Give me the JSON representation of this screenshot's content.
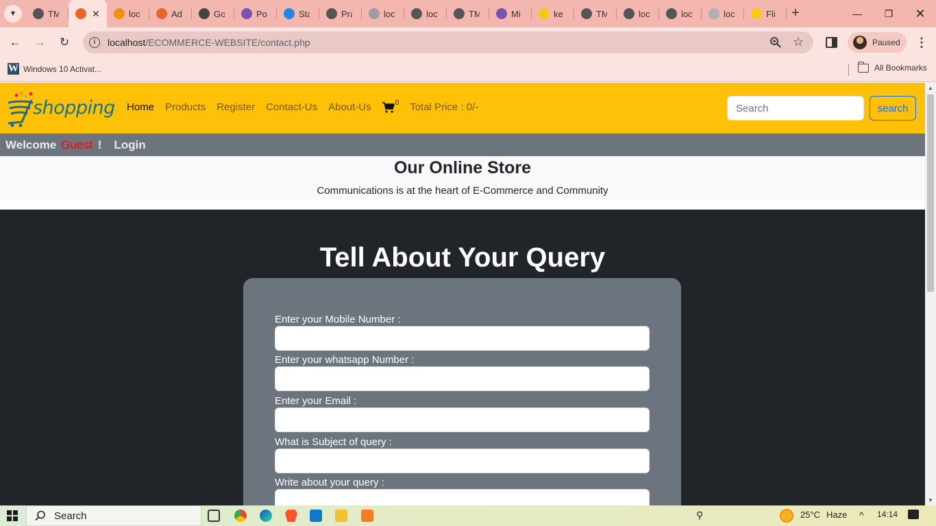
{
  "browser": {
    "tabs": [
      {
        "title": "TM",
        "favicon": "globe-icon",
        "color": "#555555"
      },
      {
        "title": "",
        "favicon": "xampp-icon",
        "color": "#e8652b",
        "active": true
      },
      {
        "title": "loc",
        "favicon": "phpmyadmin-icon",
        "color": "#f29111"
      },
      {
        "title": "Ad",
        "favicon": "xampp-icon",
        "color": "#e8652b"
      },
      {
        "title": "Go",
        "favicon": "gear-icon",
        "color": "#444444"
      },
      {
        "title": "Po",
        "favicon": "bootstrap-icon",
        "color": "#7952b3"
      },
      {
        "title": "Sta",
        "favicon": "lightning-icon",
        "color": "#1e88e5"
      },
      {
        "title": "Pra",
        "favicon": "globe-icon",
        "color": "#555555"
      },
      {
        "title": "loc",
        "favicon": "globe-icon",
        "color": "#9e9e9e"
      },
      {
        "title": "loc",
        "favicon": "globe-icon",
        "color": "#555555"
      },
      {
        "title": "TM",
        "favicon": "globe-icon",
        "color": "#555555"
      },
      {
        "title": "Mi",
        "favicon": "bootstrap-icon",
        "color": "#7952b3"
      },
      {
        "title": "ke",
        "favicon": "bulb-icon",
        "color": "#f7c815"
      },
      {
        "title": "TM",
        "favicon": "globe-icon",
        "color": "#555555"
      },
      {
        "title": "loc",
        "favicon": "globe-icon",
        "color": "#555555"
      },
      {
        "title": "loc",
        "favicon": "globe-icon",
        "color": "#555555"
      },
      {
        "title": "loc",
        "favicon": "doc-icon",
        "color": "#b0b0b0"
      },
      {
        "title": "Fli",
        "favicon": "flipkart-icon",
        "color": "#f7c815"
      }
    ],
    "url_host": "localhost",
    "url_path": "/ECOMMERCE-WEBSITE/contact.php",
    "profile_label": "Paused",
    "bookmark": "Windows 10 Activat...",
    "all_bookmarks": "All Bookmarks"
  },
  "site": {
    "logo_text": "shopping",
    "nav": {
      "home": "Home",
      "products": "Products",
      "register": "Register",
      "contact": "Contact-Us",
      "about": "About-Us",
      "cart_count": "0",
      "total_price": "Total Price : 0/-"
    },
    "search_placeholder": "Search",
    "search_button": "search",
    "welcome": "Welcome",
    "guest": "Guest",
    "exclaim": "!",
    "login": "Login",
    "store_title": "Our Online Store",
    "store_subtitle": "Communications is at the heart of E-Commerce and Community",
    "query_title": "Tell About Your Query",
    "form": {
      "mobile_label": "Enter your Mobile Number :",
      "whatsapp_label": "Enter your whatsapp Number :",
      "email_label": "Enter your Email :",
      "subject_label": "What is Subject of query :",
      "query_label": "Write about your query :"
    }
  },
  "taskbar": {
    "search_label": "Search",
    "temperature": "25°C",
    "weather": "Haze",
    "time": "14:14"
  },
  "colors": {
    "navbar": "#ffc107",
    "subnav": "#6c757d",
    "page_dark": "#212529",
    "guest_red": "#ff0000",
    "search_blue": "#0d6efd"
  }
}
